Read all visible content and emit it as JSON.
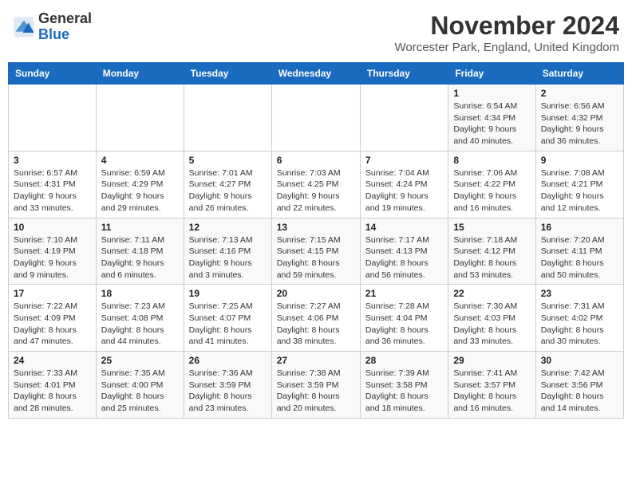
{
  "logo": {
    "general": "General",
    "blue": "Blue"
  },
  "title": "November 2024",
  "subtitle": "Worcester Park, England, United Kingdom",
  "days_of_week": [
    "Sunday",
    "Monday",
    "Tuesday",
    "Wednesday",
    "Thursday",
    "Friday",
    "Saturday"
  ],
  "weeks": [
    [
      {
        "day": "",
        "info": ""
      },
      {
        "day": "",
        "info": ""
      },
      {
        "day": "",
        "info": ""
      },
      {
        "day": "",
        "info": ""
      },
      {
        "day": "",
        "info": ""
      },
      {
        "day": "1",
        "info": "Sunrise: 6:54 AM\nSunset: 4:34 PM\nDaylight: 9 hours\nand 40 minutes."
      },
      {
        "day": "2",
        "info": "Sunrise: 6:56 AM\nSunset: 4:32 PM\nDaylight: 9 hours\nand 36 minutes."
      }
    ],
    [
      {
        "day": "3",
        "info": "Sunrise: 6:57 AM\nSunset: 4:31 PM\nDaylight: 9 hours\nand 33 minutes."
      },
      {
        "day": "4",
        "info": "Sunrise: 6:59 AM\nSunset: 4:29 PM\nDaylight: 9 hours\nand 29 minutes."
      },
      {
        "day": "5",
        "info": "Sunrise: 7:01 AM\nSunset: 4:27 PM\nDaylight: 9 hours\nand 26 minutes."
      },
      {
        "day": "6",
        "info": "Sunrise: 7:03 AM\nSunset: 4:25 PM\nDaylight: 9 hours\nand 22 minutes."
      },
      {
        "day": "7",
        "info": "Sunrise: 7:04 AM\nSunset: 4:24 PM\nDaylight: 9 hours\nand 19 minutes."
      },
      {
        "day": "8",
        "info": "Sunrise: 7:06 AM\nSunset: 4:22 PM\nDaylight: 9 hours\nand 16 minutes."
      },
      {
        "day": "9",
        "info": "Sunrise: 7:08 AM\nSunset: 4:21 PM\nDaylight: 9 hours\nand 12 minutes."
      }
    ],
    [
      {
        "day": "10",
        "info": "Sunrise: 7:10 AM\nSunset: 4:19 PM\nDaylight: 9 hours\nand 9 minutes."
      },
      {
        "day": "11",
        "info": "Sunrise: 7:11 AM\nSunset: 4:18 PM\nDaylight: 9 hours\nand 6 minutes."
      },
      {
        "day": "12",
        "info": "Sunrise: 7:13 AM\nSunset: 4:16 PM\nDaylight: 9 hours\nand 3 minutes."
      },
      {
        "day": "13",
        "info": "Sunrise: 7:15 AM\nSunset: 4:15 PM\nDaylight: 8 hours\nand 59 minutes."
      },
      {
        "day": "14",
        "info": "Sunrise: 7:17 AM\nSunset: 4:13 PM\nDaylight: 8 hours\nand 56 minutes."
      },
      {
        "day": "15",
        "info": "Sunrise: 7:18 AM\nSunset: 4:12 PM\nDaylight: 8 hours\nand 53 minutes."
      },
      {
        "day": "16",
        "info": "Sunrise: 7:20 AM\nSunset: 4:11 PM\nDaylight: 8 hours\nand 50 minutes."
      }
    ],
    [
      {
        "day": "17",
        "info": "Sunrise: 7:22 AM\nSunset: 4:09 PM\nDaylight: 8 hours\nand 47 minutes."
      },
      {
        "day": "18",
        "info": "Sunrise: 7:23 AM\nSunset: 4:08 PM\nDaylight: 8 hours\nand 44 minutes."
      },
      {
        "day": "19",
        "info": "Sunrise: 7:25 AM\nSunset: 4:07 PM\nDaylight: 8 hours\nand 41 minutes."
      },
      {
        "day": "20",
        "info": "Sunrise: 7:27 AM\nSunset: 4:06 PM\nDaylight: 8 hours\nand 38 minutes."
      },
      {
        "day": "21",
        "info": "Sunrise: 7:28 AM\nSunset: 4:04 PM\nDaylight: 8 hours\nand 36 minutes."
      },
      {
        "day": "22",
        "info": "Sunrise: 7:30 AM\nSunset: 4:03 PM\nDaylight: 8 hours\nand 33 minutes."
      },
      {
        "day": "23",
        "info": "Sunrise: 7:31 AM\nSunset: 4:02 PM\nDaylight: 8 hours\nand 30 minutes."
      }
    ],
    [
      {
        "day": "24",
        "info": "Sunrise: 7:33 AM\nSunset: 4:01 PM\nDaylight: 8 hours\nand 28 minutes."
      },
      {
        "day": "25",
        "info": "Sunrise: 7:35 AM\nSunset: 4:00 PM\nDaylight: 8 hours\nand 25 minutes."
      },
      {
        "day": "26",
        "info": "Sunrise: 7:36 AM\nSunset: 3:59 PM\nDaylight: 8 hours\nand 23 minutes."
      },
      {
        "day": "27",
        "info": "Sunrise: 7:38 AM\nSunset: 3:59 PM\nDaylight: 8 hours\nand 20 minutes."
      },
      {
        "day": "28",
        "info": "Sunrise: 7:39 AM\nSunset: 3:58 PM\nDaylight: 8 hours\nand 18 minutes."
      },
      {
        "day": "29",
        "info": "Sunrise: 7:41 AM\nSunset: 3:57 PM\nDaylight: 8 hours\nand 16 minutes."
      },
      {
        "day": "30",
        "info": "Sunrise: 7:42 AM\nSunset: 3:56 PM\nDaylight: 8 hours\nand 14 minutes."
      }
    ]
  ]
}
